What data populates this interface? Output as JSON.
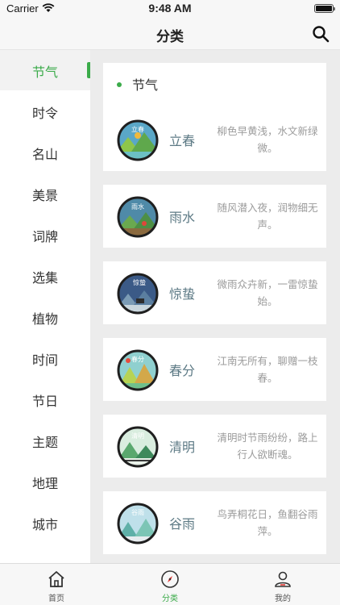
{
  "status": {
    "carrier": "Carrier",
    "time": "9:48 AM"
  },
  "nav": {
    "title": "分类",
    "search_icon": "search-icon"
  },
  "sidebar": {
    "items": [
      {
        "label": "节气",
        "active": true
      },
      {
        "label": "时令"
      },
      {
        "label": "名山"
      },
      {
        "label": "美景"
      },
      {
        "label": "词牌"
      },
      {
        "label": "选集"
      },
      {
        "label": "植物"
      },
      {
        "label": "时间"
      },
      {
        "label": "节日"
      },
      {
        "label": "主题"
      },
      {
        "label": "地理"
      },
      {
        "label": "城市"
      }
    ]
  },
  "content": {
    "section_title": "节气",
    "terms": [
      {
        "name": "立春",
        "icon_text": "立春",
        "desc": "柳色早黄浅，水文新绿微。"
      },
      {
        "name": "雨水",
        "icon_text": "雨水",
        "desc": "随风潜入夜，润物细无声。"
      },
      {
        "name": "惊蛰",
        "icon_text": "惊蛰",
        "desc": "微雨众卉新，一雷惊蛰始。"
      },
      {
        "name": "春分",
        "icon_text": "春分",
        "desc": "江南无所有，聊赠一枝春。"
      },
      {
        "name": "清明",
        "icon_text": "清明",
        "desc": "清明时节雨纷纷，路上行人欲断魂。"
      },
      {
        "name": "谷雨",
        "icon_text": "谷雨",
        "desc": "鸟弄桐花日，鱼翻谷雨萍。"
      }
    ]
  },
  "tabs": [
    {
      "label": "首页",
      "icon": "home-icon"
    },
    {
      "label": "分类",
      "icon": "compass-icon",
      "active": true
    },
    {
      "label": "我的",
      "icon": "profile-icon"
    }
  ],
  "colors": {
    "accent": "#3bab4a",
    "term_name": "#5d7a85",
    "desc": "#9b9b9b"
  }
}
